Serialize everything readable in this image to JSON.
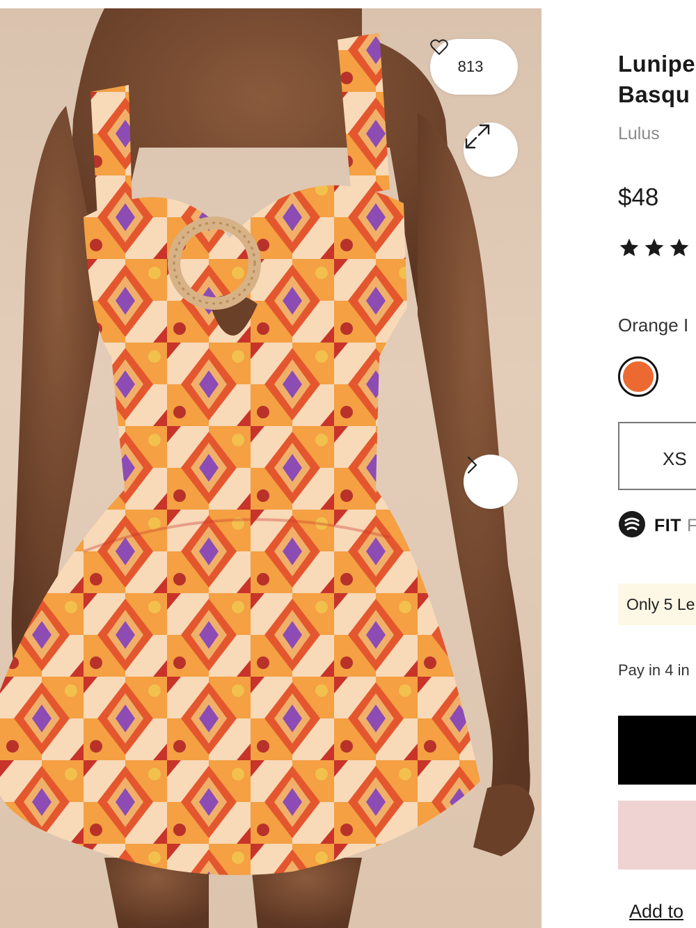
{
  "gallery": {
    "favorite_count": "813"
  },
  "product": {
    "title_line1": "Lunipe",
    "title_line2": "Basqu",
    "brand": "Lulus",
    "price": "$48",
    "rating_stars": 3,
    "color_label": "Orange I",
    "swatch_color": "#ec6a31",
    "size_label": "XS",
    "fit_label": "FIT",
    "fit_rest": "F",
    "stock_notice": "Only 5 Le",
    "pay_text": "Pay in 4 in",
    "add_link": "Add to"
  },
  "icons": {
    "favorite": "heart-outline-icon",
    "expand": "expand-arrows-icon",
    "next": "chevron-right-icon",
    "fit": "fit-predictor-icon",
    "star": "star-icon"
  }
}
